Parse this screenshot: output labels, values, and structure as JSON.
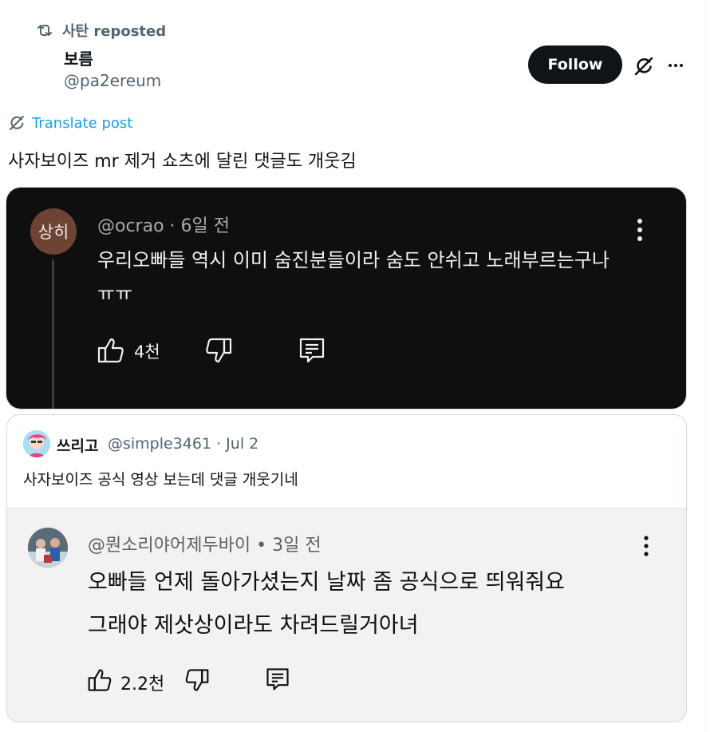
{
  "repost": {
    "label": "사탄 reposted"
  },
  "author": {
    "name": "보름",
    "handle": "@pa2ereum"
  },
  "actions": {
    "follow_label": "Follow"
  },
  "translate_label": "Translate post",
  "post_text": "사자보이즈 mr 제거 쇼츠에 달린 댓글도 개웃김",
  "dark_comment": {
    "avatar_text": "상히",
    "handle_time": "@ocrao · 6일 전",
    "text": "우리오빠들 역시 이미 숨진분들이라 숨도 안쉬고 노래부르는구나 ㅠㅠ",
    "likes": "4천"
  },
  "quote": {
    "name": "쓰리고",
    "meta": "@simple3461 · Jul 2",
    "text": "사자보이즈 공식 영상 보는데 댓글 개웃기네",
    "comment": {
      "handle_time": "@뭔소리야어제두바이 • 3일 전",
      "line1": "오빠들 언제 돌아가셨는지 날짜 좀 공식으로 띄워줘요",
      "line2": "그래야 제삿상이라도 차려드릴거아녀",
      "likes": "2.2천"
    }
  },
  "colors": {
    "accent": "#1d9bf0",
    "follow_bg": "#0f1419",
    "dark_card": "#0f0f0f",
    "light_card": "#f2f2f2"
  }
}
